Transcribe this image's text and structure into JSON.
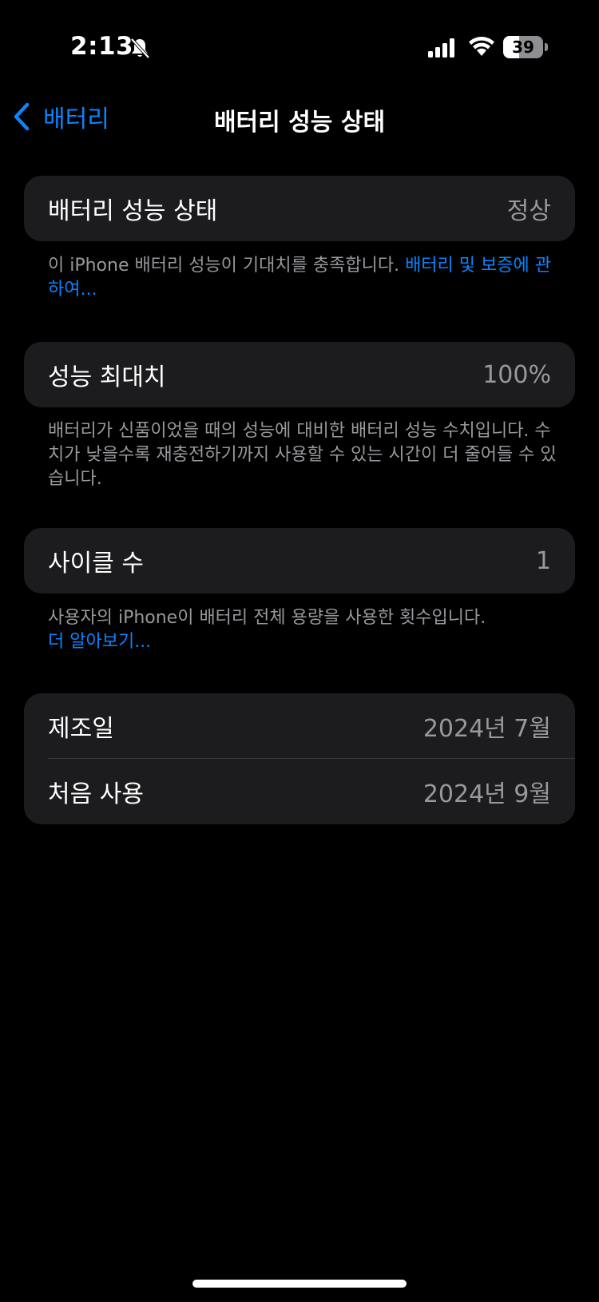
{
  "status_bar": {
    "time": "2:13",
    "battery_percent": "39",
    "battery_level": 0.39,
    "icons": [
      "bell-slash-icon",
      "cellular-signal-icon",
      "wifi-icon",
      "battery-icon"
    ]
  },
  "nav": {
    "back_label": "배터리",
    "title": "배터리 성능 상태"
  },
  "health": {
    "label": "배터리 성능 상태",
    "value": "정상",
    "footer_text": "이 iPhone 배터리 성능이 기대치를 충족합니다. ",
    "footer_link": "배터리 및 보증에 관하여..."
  },
  "capacity": {
    "label": "성능 최대치",
    "value": "100%",
    "footer_text": "배터리가 신품이었을 때의 성능에 대비한 배터리 성능 수치입니다. 수치가 낮을수록 재충전하기까지 사용할 수 있는 시간이 더 줄어들 수 있습니다."
  },
  "cycles": {
    "label": "사이클 수",
    "value": "1",
    "footer_text": "사용자의 iPhone이 배터리 전체 용량을 사용한 횟수입니다.",
    "footer_link": "더 알아보기..."
  },
  "dates": {
    "manufactured_label": "제조일",
    "manufactured_value": "2024년 7월",
    "first_use_label": "처음 사용",
    "first_use_value": "2024년 9월"
  },
  "colors": {
    "accent": "#0a84ff",
    "group_bg": "#1c1c1e",
    "secondary_text": "#98989d"
  }
}
